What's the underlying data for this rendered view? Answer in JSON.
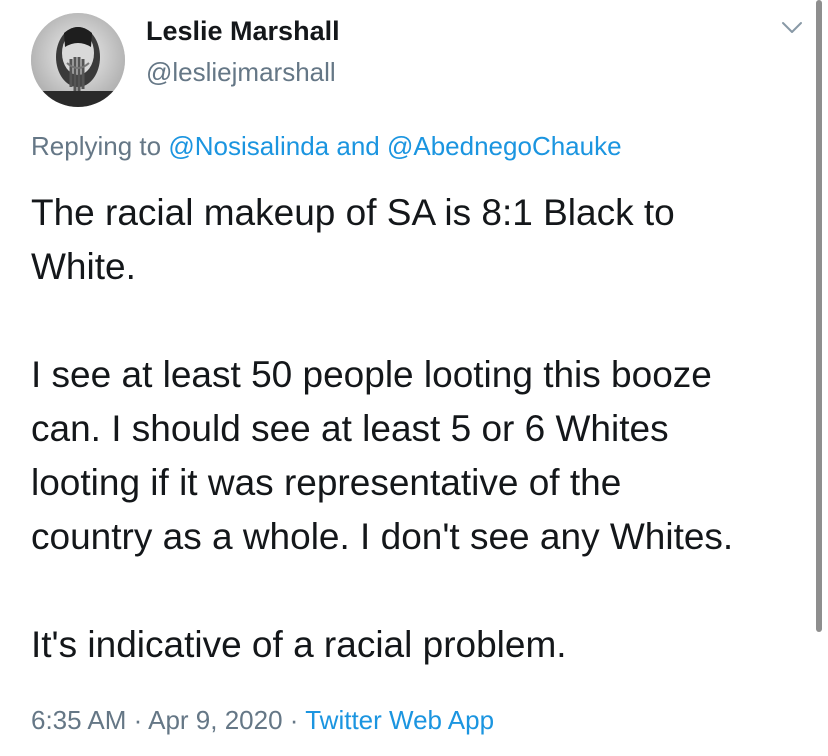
{
  "author": {
    "display_name": "Leslie Marshall",
    "handle": "@lesliejmarshall",
    "avatar_icon": "avatar-image"
  },
  "menu": {
    "icon": "chevron-down-icon"
  },
  "reply": {
    "prefix": "Replying to",
    "mention_1": "@Nosisalinda",
    "conjunction": "and",
    "mention_2": "@AbednegoChauke"
  },
  "tweet": {
    "line_1": "The racial makeup of SA is 8:1 Black to",
    "line_2": "White.",
    "line_3": "I see at least 50 people looting this booze",
    "line_4": "can. I should see at least 5 or 6 Whites",
    "line_5": "looting if it was representative of the",
    "line_6": "country as a whole. I don't see any Whites.",
    "line_7": "It's indicative of a racial problem."
  },
  "meta": {
    "time": "6:35 AM",
    "separator": "·",
    "date": "Apr 9, 2020",
    "source": "Twitter Web App"
  },
  "colors": {
    "text": "#14171a",
    "secondary": "#657786",
    "link": "#1b95e0"
  }
}
